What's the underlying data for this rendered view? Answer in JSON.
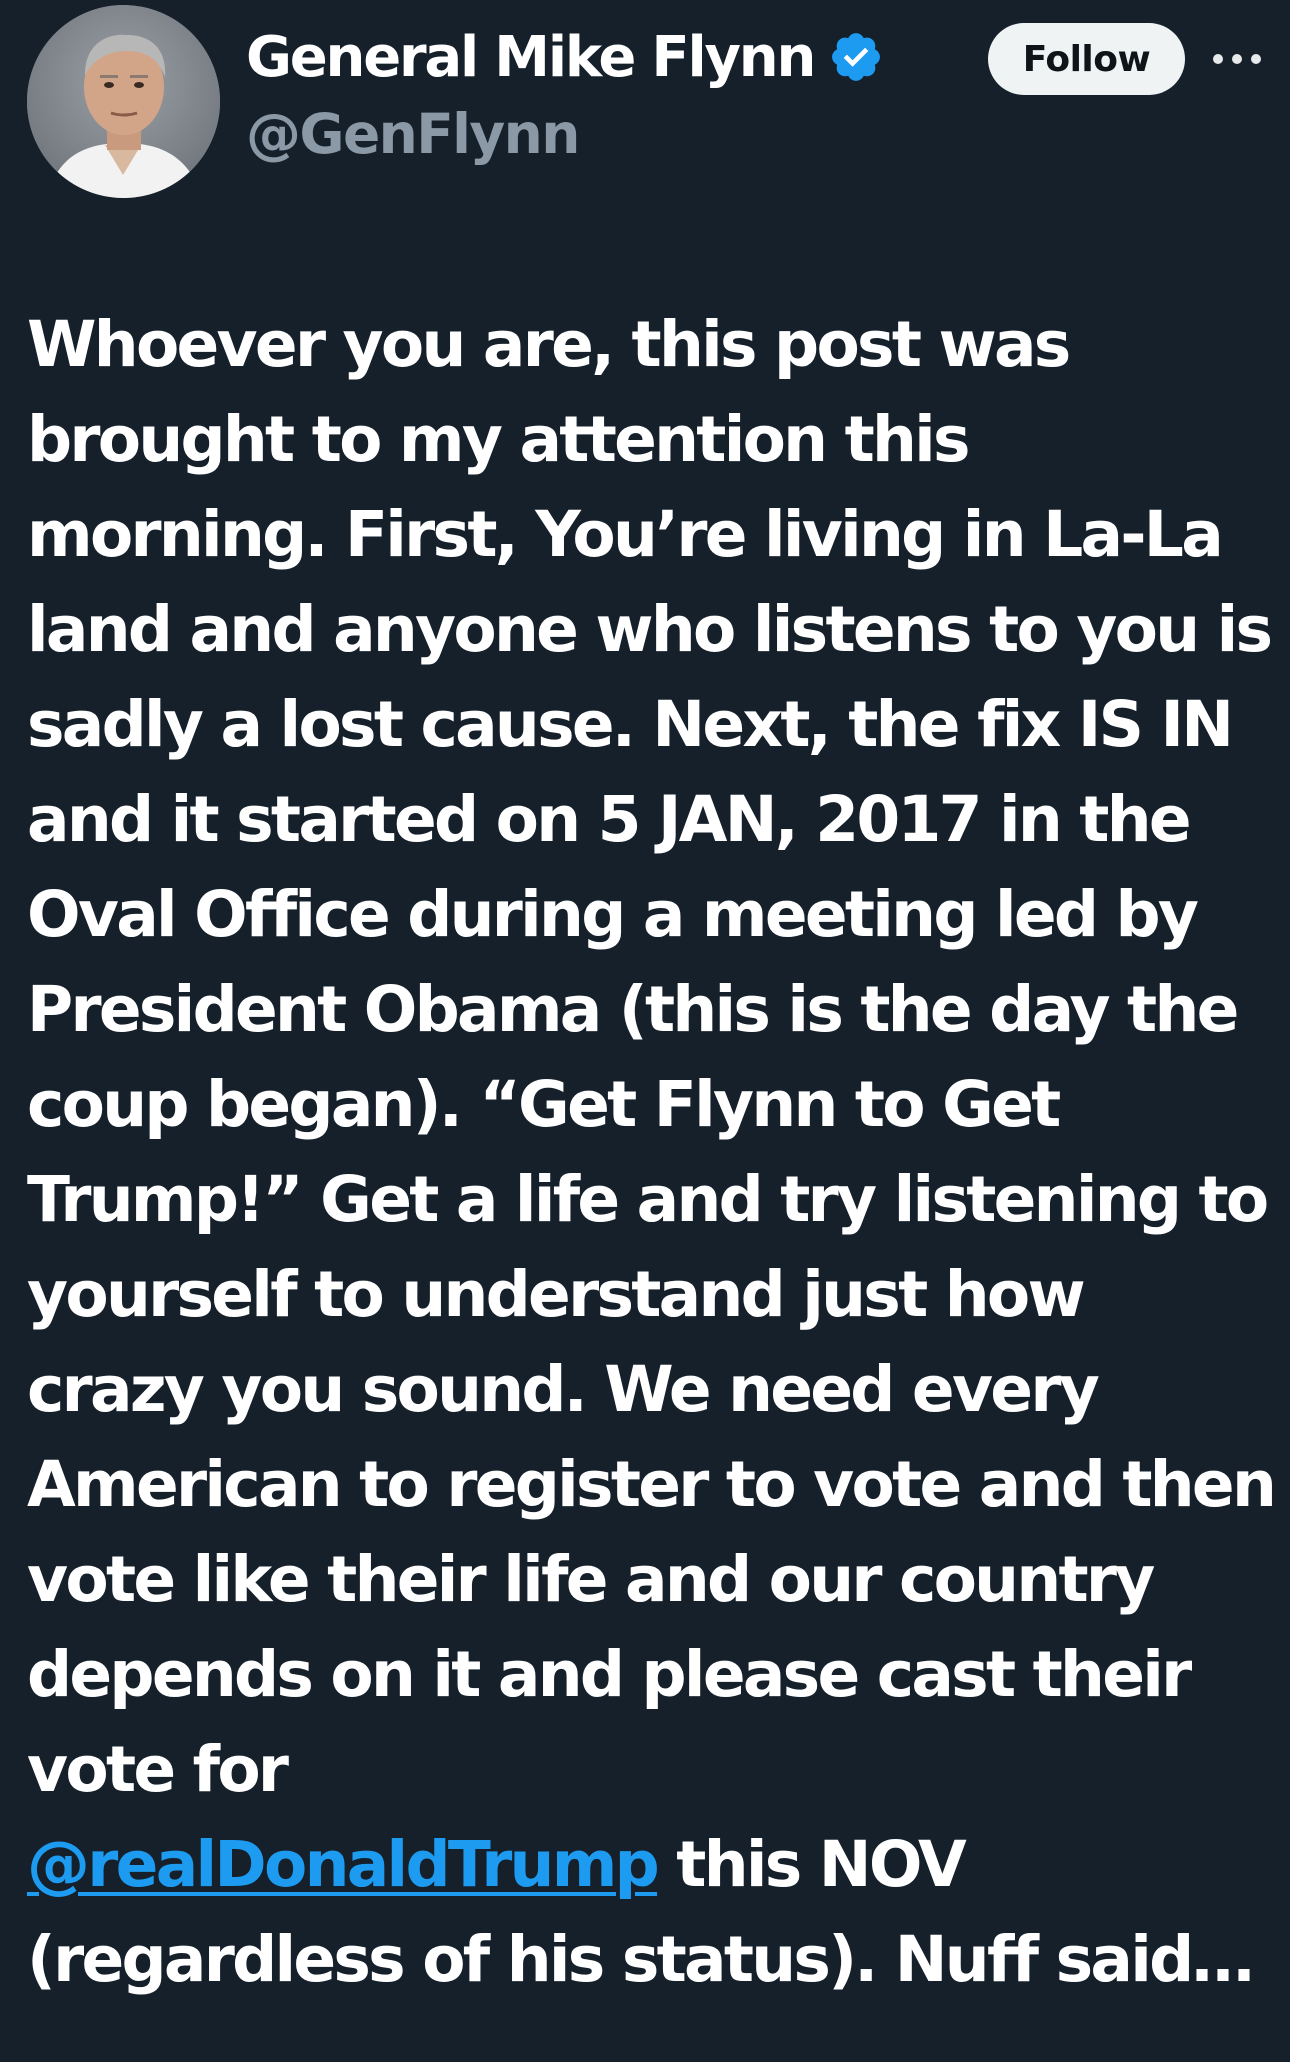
{
  "author": {
    "display_name": "General Mike Flynn",
    "handle": "@GenFlynn",
    "verified_icon": "verified-badge-icon",
    "avatar_icon": "avatar-photo"
  },
  "actions": {
    "follow_label": "Follow",
    "more_icon": "more-options-icon"
  },
  "tweet": {
    "text_before_mention": "Whoever you are, this post was brought to my attention this morning. First, You’re living in La-La land and anyone who listens to you is sadly a lost cause. Next, the fix IS IN and it started on 5 JAN, 2017 in the Oval Office during a meeting led by President Obama (this is the day the coup began). “Get Flynn to Get Trump!” Get a life and try listening to yourself to understand just how crazy you sound. We need every American to register to vote and then vote like their life and our country depends on it and please cast their vote for\n",
    "mention": "@realDonaldTrump",
    "text_after_mention": " this NOV (regardless of his status). Nuff said…"
  },
  "colors": {
    "background": "#15202b",
    "text": "#ffffff",
    "secondary_text": "#8b98a5",
    "link": "#1d9bf0",
    "verified": "#1d9bf0",
    "follow_button_bg": "#eff3f4"
  }
}
